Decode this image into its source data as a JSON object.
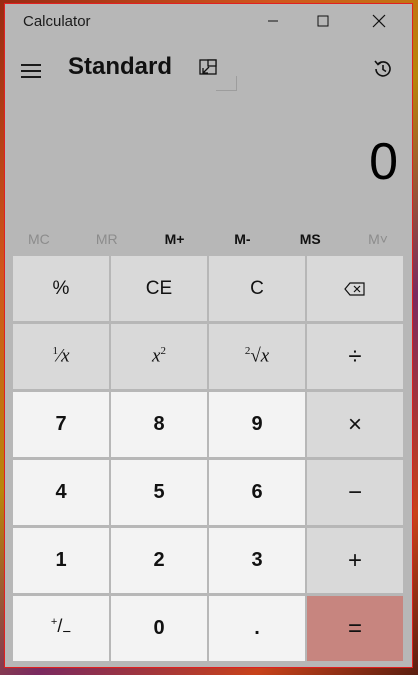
{
  "window": {
    "title": "Calculator",
    "controls": {
      "minimize_icon": "minimize-icon",
      "maximize_icon": "maximize-icon",
      "close_icon": "close-icon"
    }
  },
  "header": {
    "mode_title": "Standard",
    "menu_icon": "hamburger-menu-icon",
    "keep_on_top_icon": "keep-on-top-icon",
    "history_icon": "history-icon"
  },
  "display": {
    "value": "0"
  },
  "memory": {
    "mc": "MC",
    "mr": "MR",
    "m_plus": "M+",
    "m_minus": "M-",
    "ms": "MS",
    "m_list": "M˅"
  },
  "keys": {
    "percent": "%",
    "clear_entry": "CE",
    "clear": "C",
    "backspace_icon": "backspace-icon",
    "seven": "7",
    "eight": "8",
    "nine": "9",
    "four": "4",
    "five": "5",
    "six": "6",
    "one": "1",
    "two": "2",
    "three": "3",
    "zero": "0",
    "decimal": ".",
    "divide": "÷",
    "multiply": "×",
    "minus": "−",
    "plus": "+",
    "equals": "="
  },
  "colors": {
    "window_bg": "#b7b7b7",
    "function_key_bg": "#d9d9d9",
    "number_key_bg": "#f3f3f3",
    "equals_key_bg": "#c7857f",
    "window_border": "#e02020"
  }
}
